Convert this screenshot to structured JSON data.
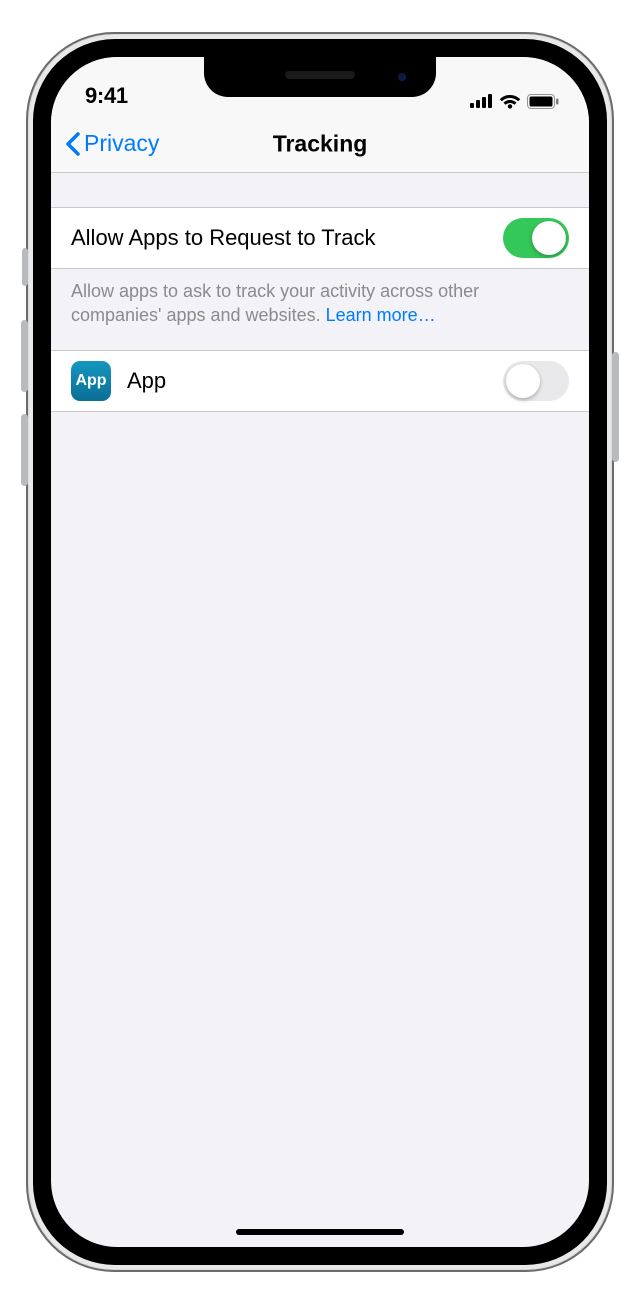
{
  "status": {
    "time": "9:41"
  },
  "nav": {
    "back_label": "Privacy",
    "title": "Tracking"
  },
  "main": {
    "allow_label": "Allow Apps to Request to Track",
    "allow_on": true,
    "footer_text": "Allow apps to ask to track your activity across other companies' apps and websites. ",
    "footer_link": "Learn more…"
  },
  "apps": [
    {
      "icon_text": "App",
      "name": "App",
      "tracking_on": false
    }
  ]
}
